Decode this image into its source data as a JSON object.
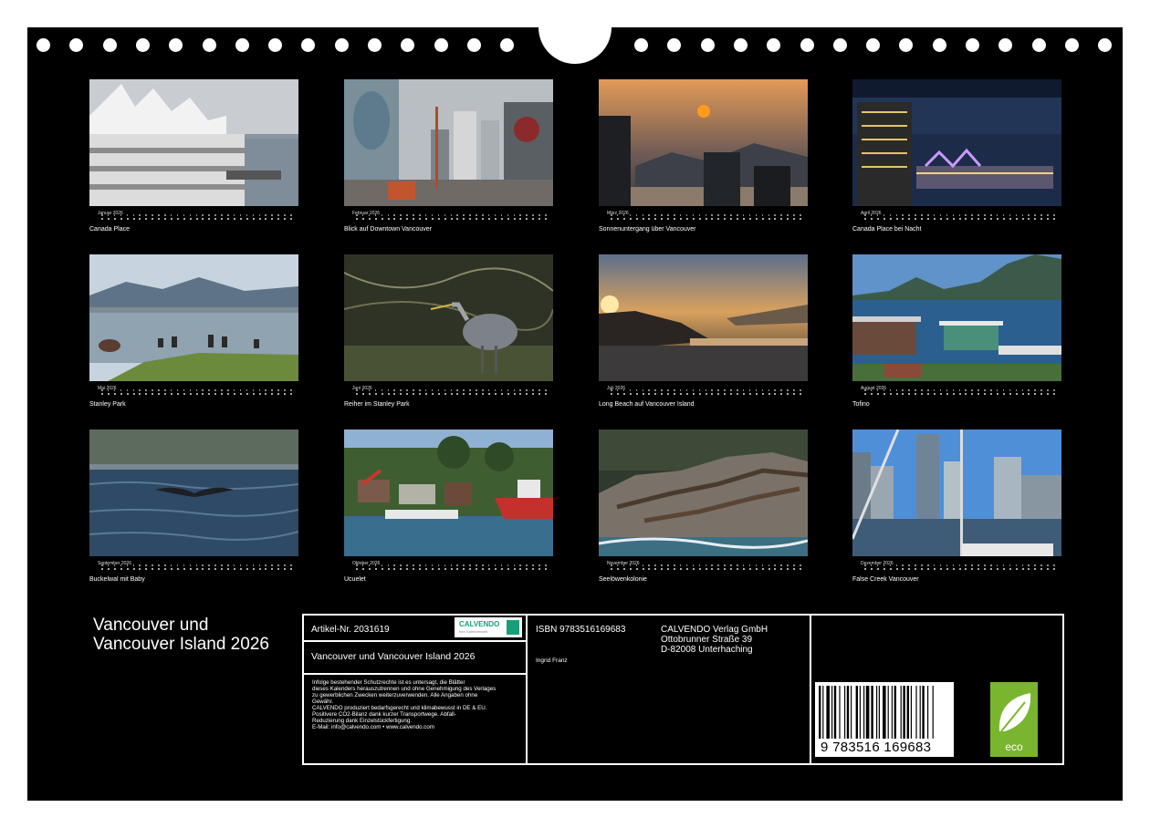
{
  "calendar": {
    "title_line1": "Vancouver und",
    "title_line2": "Vancouver Island 2026",
    "year": "2026",
    "months": [
      {
        "name": "Januar",
        "caption": "Canada Place"
      },
      {
        "name": "Februar",
        "caption": "Blick auf Downtown Vancouver"
      },
      {
        "name": "März",
        "caption": "Sonnenuntergang über Vancouver"
      },
      {
        "name": "April",
        "caption": "Canada Place bei Nacht"
      },
      {
        "name": "Mai",
        "caption": "Stanley Park"
      },
      {
        "name": "Juni",
        "caption": "Reiher im Stanley Park"
      },
      {
        "name": "Juli",
        "caption": "Long Beach auf Vancouver Island"
      },
      {
        "name": "August",
        "caption": "Tofino"
      },
      {
        "name": "September",
        "caption": "Buckelwal mit Baby"
      },
      {
        "name": "Oktober",
        "caption": "Ucuelet"
      },
      {
        "name": "November",
        "caption": "Seelöwenkolonie"
      },
      {
        "name": "Dezember",
        "caption": "False Creek Vancouver"
      }
    ]
  },
  "imprint": {
    "article": "Artikel-Nr. 2031619",
    "logo_text": "CALVENDO",
    "logo_sub": "Ihre Kalenderwelt",
    "product_title": "Vancouver und Vancouver Island 2026",
    "legal_text": "Infolge bestehender Schutzrechte ist es untersagt, die Blätter\ndieses Kalenders herauszutrennen und ohne Genehmigung des Verlages\nzu gewerblichen Zwecken weiterzuverwenden. Alle Angaben ohne\nGewähr.\nCALVENDO produziert bedarfsgerecht und klimabewusst in DE & EU.\nPositivere CO2-Bilanz dank kurzer Transportwege. Abfall-\nReduzierung dank Einzelstückfertigung.\nE-Mail: info@calvendo.com • www.calvendo.com",
    "isbn": "ISBN 9783516169683",
    "author": "Ingrid Franz",
    "publisher_line1": "CALVENDO Verlag GmbH",
    "publisher_line2": "Ottobrunner Straße 39",
    "publisher_line3": "D-82008 Unterhaching",
    "barcode_number": "9 783516 169683",
    "eco_label": "eco"
  },
  "colors": {
    "background": "#000000",
    "paper": "#ffffff",
    "calvendo_green": "#1a9e7a",
    "eco_green": "#7ab530"
  }
}
